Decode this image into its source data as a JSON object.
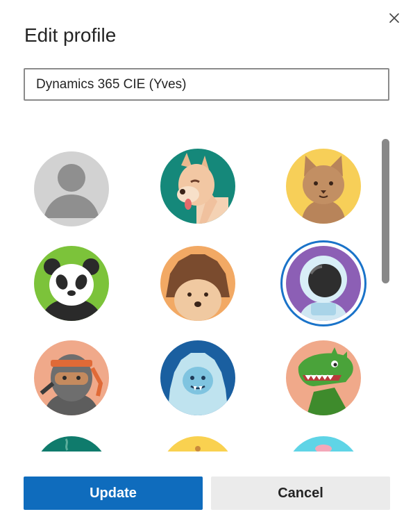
{
  "dialog": {
    "title": "Edit profile",
    "close_label": "close-icon",
    "name_value": "Dynamics 365 CIE (Yves)"
  },
  "avatars": [
    {
      "name": "default-person",
      "selected": false
    },
    {
      "name": "fox",
      "selected": false
    },
    {
      "name": "cat",
      "selected": false
    },
    {
      "name": "panda",
      "selected": false
    },
    {
      "name": "hedgehog",
      "selected": false
    },
    {
      "name": "astronaut",
      "selected": true
    },
    {
      "name": "ninja",
      "selected": false
    },
    {
      "name": "yeti",
      "selected": false
    },
    {
      "name": "dinosaur",
      "selected": false
    },
    {
      "name": "teal-avatar-partial",
      "selected": false
    },
    {
      "name": "yellow-avatar-partial",
      "selected": false
    },
    {
      "name": "cyan-avatar-partial",
      "selected": false
    }
  ],
  "actions": {
    "update_label": "Update",
    "cancel_label": "Cancel"
  },
  "colors": {
    "primary": "#0f6cbd",
    "selected_ring": "#1a73c9",
    "secondary_bg": "#ebebeb"
  }
}
